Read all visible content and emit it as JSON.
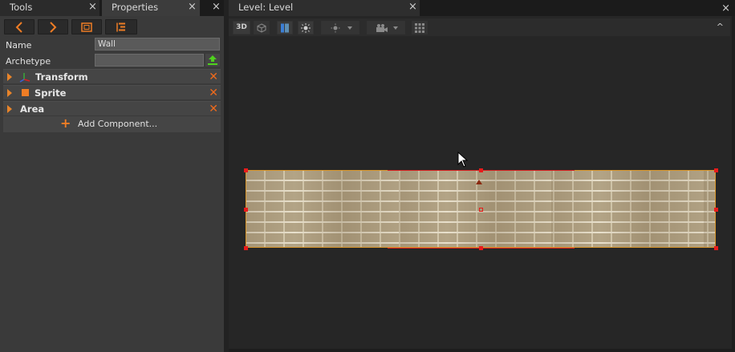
{
  "tabs_left": [
    {
      "label": "Tools",
      "close": "×"
    },
    {
      "label": "Properties",
      "close": "×"
    }
  ],
  "tabs_left_extra_close": "×",
  "tab_level": {
    "label": "Level: Level",
    "close": "×"
  },
  "window_close": "×",
  "toolbar": {
    "back_icon": "chevron-left-icon",
    "forward_icon": "chevron-right-icon",
    "focus_icon": "focus-frame-icon",
    "tree_icon": "hierarchy-icon"
  },
  "properties": {
    "name_label": "Name",
    "name_value": "Wall",
    "archetype_label": "Archetype",
    "archetype_value": "",
    "upload_icon": "upload-icon"
  },
  "components": [
    {
      "name": "Transform",
      "icon": "axes-icon",
      "remove": "✕"
    },
    {
      "name": "Sprite",
      "icon": "square-icon",
      "remove": "✕"
    },
    {
      "name": "Area",
      "icon": "",
      "remove": "✕"
    }
  ],
  "add_component": {
    "plus": "+",
    "label": "Add Component..."
  },
  "viewport_toolbar": {
    "mode_3d": "3D",
    "collapse": "^"
  },
  "colors": {
    "accent_orange": "#ef7d25",
    "selection_red": "#e81b1b",
    "panel_bg": "#3a3a3a",
    "viewport_bg": "#262626"
  }
}
